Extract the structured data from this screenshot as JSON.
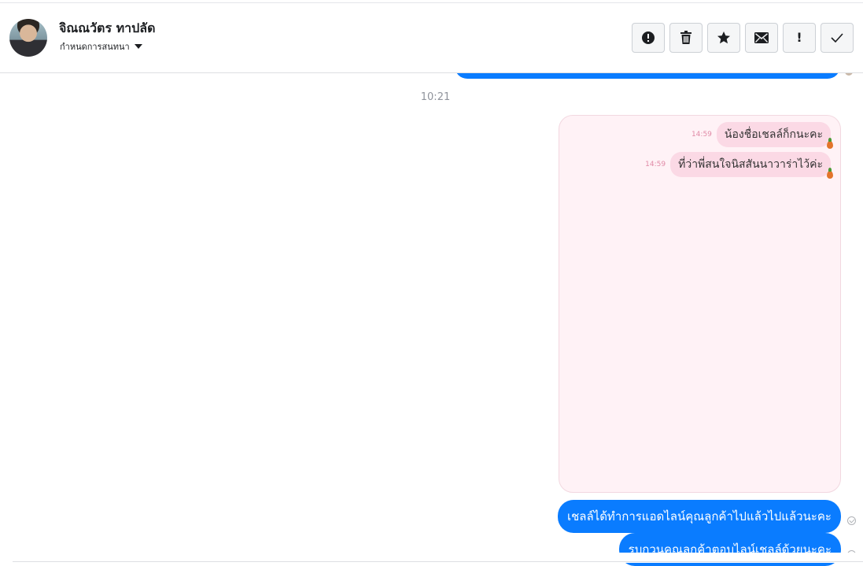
{
  "header": {
    "name": "จิณณวัตร ทาปลัด",
    "tag_label": "กำหนดการสนทนา",
    "actions": [
      {
        "icon": "alert-circle-icon"
      },
      {
        "icon": "trash-icon"
      },
      {
        "icon": "star-icon"
      },
      {
        "icon": "envelope-icon"
      },
      {
        "icon": "exclamation-icon",
        "label": "!"
      },
      {
        "icon": "check-icon"
      }
    ]
  },
  "conversation": {
    "timestamp": "10:21",
    "card_messages": [
      {
        "text": "น้องชื่อเชลล์ก็กนะคะ",
        "time": "14:59"
      },
      {
        "text": "ที่ว่าพี่สนใจนิสสันนาวาร่าไว้ค่ะ",
        "time": "14:59"
      }
    ],
    "outgoing": [
      {
        "text": "เชลล์ได้ทำการแอดไลน์คุณลูกค้าไปแล้วไปแล้วนะคะ"
      },
      {
        "text": "รบกวนคุณลูกค้าตอบไลน์เชลล์ด้วยนะคะ"
      }
    ]
  },
  "colors": {
    "outgoing_bubble": "#0a7cff",
    "card_background": "#fff2f6",
    "card_bubble": "#fbd9e5",
    "card_time": "#e08aa6"
  }
}
